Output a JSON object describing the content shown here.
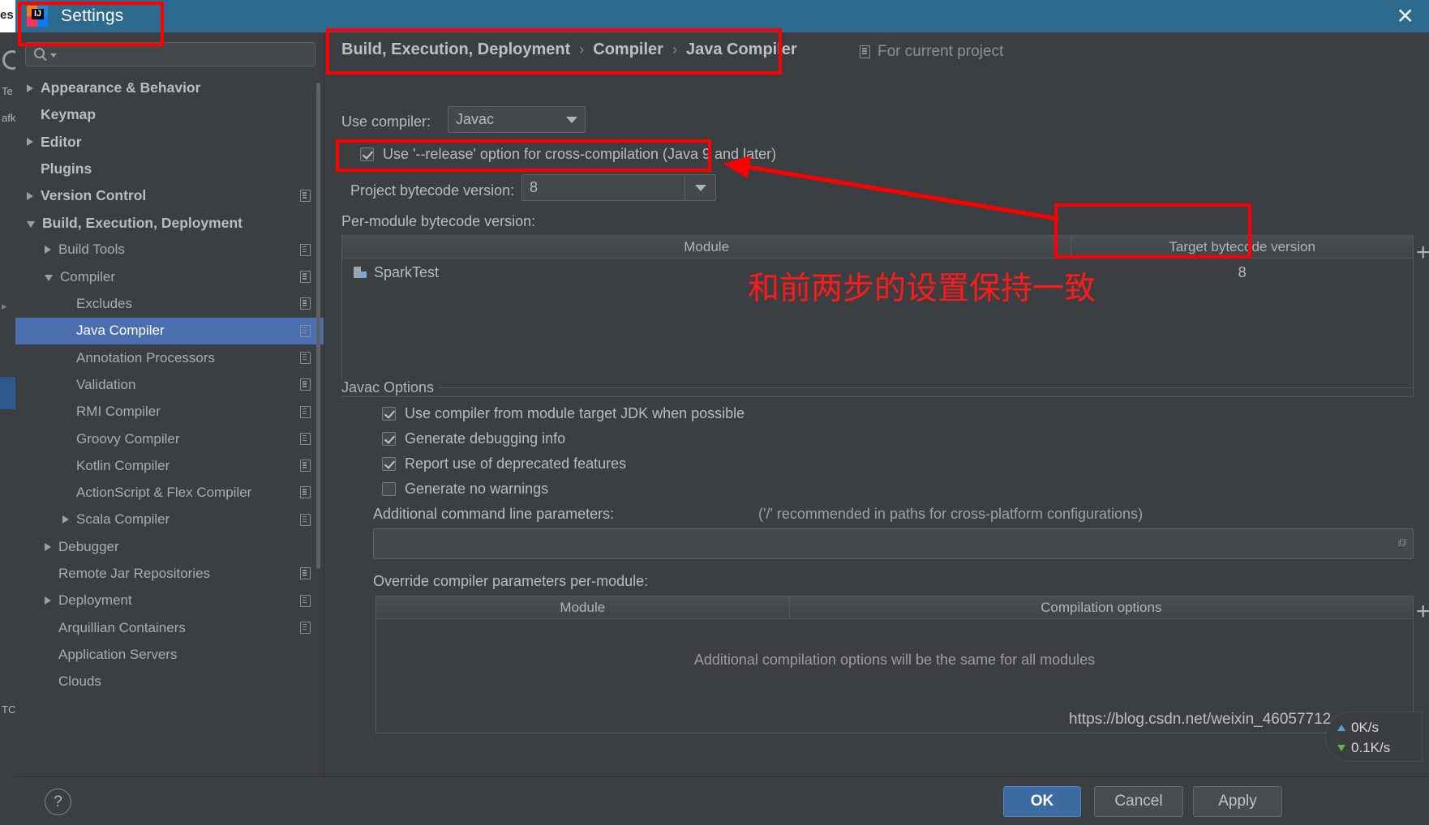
{
  "window": {
    "title": "Settings",
    "close_label": "✕",
    "app_icon": "intellij-idea-logo",
    "search_placeholder": ""
  },
  "background_app": {
    "labels": [
      "es",
      "Te",
      "afk",
      "TC"
    ]
  },
  "sidebar": {
    "items": [
      {
        "label": "Appearance & Behavior",
        "indent": 0,
        "twisty": "right",
        "bold": true,
        "selected": false,
        "badge": false
      },
      {
        "label": "Keymap",
        "indent": 0,
        "twisty": "none",
        "bold": true,
        "selected": false,
        "badge": false
      },
      {
        "label": "Editor",
        "indent": 0,
        "twisty": "right",
        "bold": true,
        "selected": false,
        "badge": false
      },
      {
        "label": "Plugins",
        "indent": 0,
        "twisty": "none",
        "bold": true,
        "selected": false,
        "badge": false
      },
      {
        "label": "Version Control",
        "indent": 0,
        "twisty": "right",
        "bold": true,
        "selected": false,
        "badge": true
      },
      {
        "label": "Build, Execution, Deployment",
        "indent": 0,
        "twisty": "down",
        "bold": true,
        "selected": false,
        "badge": false
      },
      {
        "label": "Build Tools",
        "indent": 1,
        "twisty": "right",
        "bold": false,
        "selected": false,
        "badge": true
      },
      {
        "label": "Compiler",
        "indent": 1,
        "twisty": "down",
        "bold": false,
        "selected": false,
        "badge": true
      },
      {
        "label": "Excludes",
        "indent": 2,
        "twisty": "none",
        "bold": false,
        "selected": false,
        "badge": true
      },
      {
        "label": "Java Compiler",
        "indent": 2,
        "twisty": "none",
        "bold": false,
        "selected": true,
        "badge": true
      },
      {
        "label": "Annotation Processors",
        "indent": 2,
        "twisty": "none",
        "bold": false,
        "selected": false,
        "badge": true
      },
      {
        "label": "Validation",
        "indent": 2,
        "twisty": "none",
        "bold": false,
        "selected": false,
        "badge": true
      },
      {
        "label": "RMI Compiler",
        "indent": 2,
        "twisty": "none",
        "bold": false,
        "selected": false,
        "badge": true
      },
      {
        "label": "Groovy Compiler",
        "indent": 2,
        "twisty": "none",
        "bold": false,
        "selected": false,
        "badge": true
      },
      {
        "label": "Kotlin Compiler",
        "indent": 2,
        "twisty": "none",
        "bold": false,
        "selected": false,
        "badge": true
      },
      {
        "label": "ActionScript & Flex Compiler",
        "indent": 2,
        "twisty": "none",
        "bold": false,
        "selected": false,
        "badge": true
      },
      {
        "label": "Scala Compiler",
        "indent": 2,
        "twisty": "right",
        "bold": false,
        "selected": false,
        "badge": true
      },
      {
        "label": "Debugger",
        "indent": 1,
        "twisty": "right",
        "bold": false,
        "selected": false,
        "badge": false
      },
      {
        "label": "Remote Jar Repositories",
        "indent": 1,
        "twisty": "none",
        "bold": false,
        "selected": false,
        "badge": true
      },
      {
        "label": "Deployment",
        "indent": 1,
        "twisty": "right",
        "bold": false,
        "selected": false,
        "badge": true
      },
      {
        "label": "Arquillian Containers",
        "indent": 1,
        "twisty": "none",
        "bold": false,
        "selected": false,
        "badge": true
      },
      {
        "label": "Application Servers",
        "indent": 1,
        "twisty": "none",
        "bold": false,
        "selected": false,
        "badge": false
      },
      {
        "label": "Clouds",
        "indent": 1,
        "twisty": "none",
        "bold": false,
        "selected": false,
        "badge": false
      }
    ]
  },
  "breadcrumb": {
    "parts": [
      "Build, Execution, Deployment",
      "Compiler",
      "Java Compiler"
    ],
    "separator": "›",
    "scope_label": "For current project"
  },
  "form": {
    "use_compiler_label": "Use compiler:",
    "use_compiler_value": "Javac",
    "release_option_label": "Use '--release' option for cross-compilation (Java 9 and later)",
    "release_option_checked": true,
    "project_bytecode_label": "Project bytecode version:",
    "project_bytecode_value": "8",
    "per_module_label": "Per-module bytecode version:"
  },
  "module_table": {
    "headers": [
      "Module",
      "Target bytecode version"
    ],
    "rows": [
      {
        "module": "SparkTest",
        "target": "8"
      }
    ],
    "add_button": "+"
  },
  "javac_options": {
    "group_title": "Javac Options",
    "checkboxes": [
      {
        "label": "Use compiler from module target JDK when possible",
        "checked": true
      },
      {
        "label": "Generate debugging info",
        "checked": true
      },
      {
        "label": "Report use of deprecated features",
        "checked": true
      },
      {
        "label": "Generate no warnings",
        "checked": false
      }
    ],
    "params_label": "Additional command line parameters:",
    "params_hint": "('/' recommended in paths for cross-platform configurations)",
    "params_value": "",
    "override_label": "Override compiler parameters per-module:",
    "override_headers": [
      "Module",
      "Compilation options"
    ],
    "override_empty_message": "Additional compilation options will be the same for all modules",
    "override_add_button": "+"
  },
  "footer": {
    "help_label": "?",
    "ok_label": "OK",
    "cancel_label": "Cancel",
    "apply_label": "Apply"
  },
  "annotations": {
    "note_text": "和前两步的设置保持一致",
    "highlight_color": "#ff0000"
  },
  "watermark": {
    "url": "https://blog.csdn.net/weixin_46057712"
  },
  "network_widget": {
    "upload": "0K/s",
    "download": "0.1K/s"
  }
}
